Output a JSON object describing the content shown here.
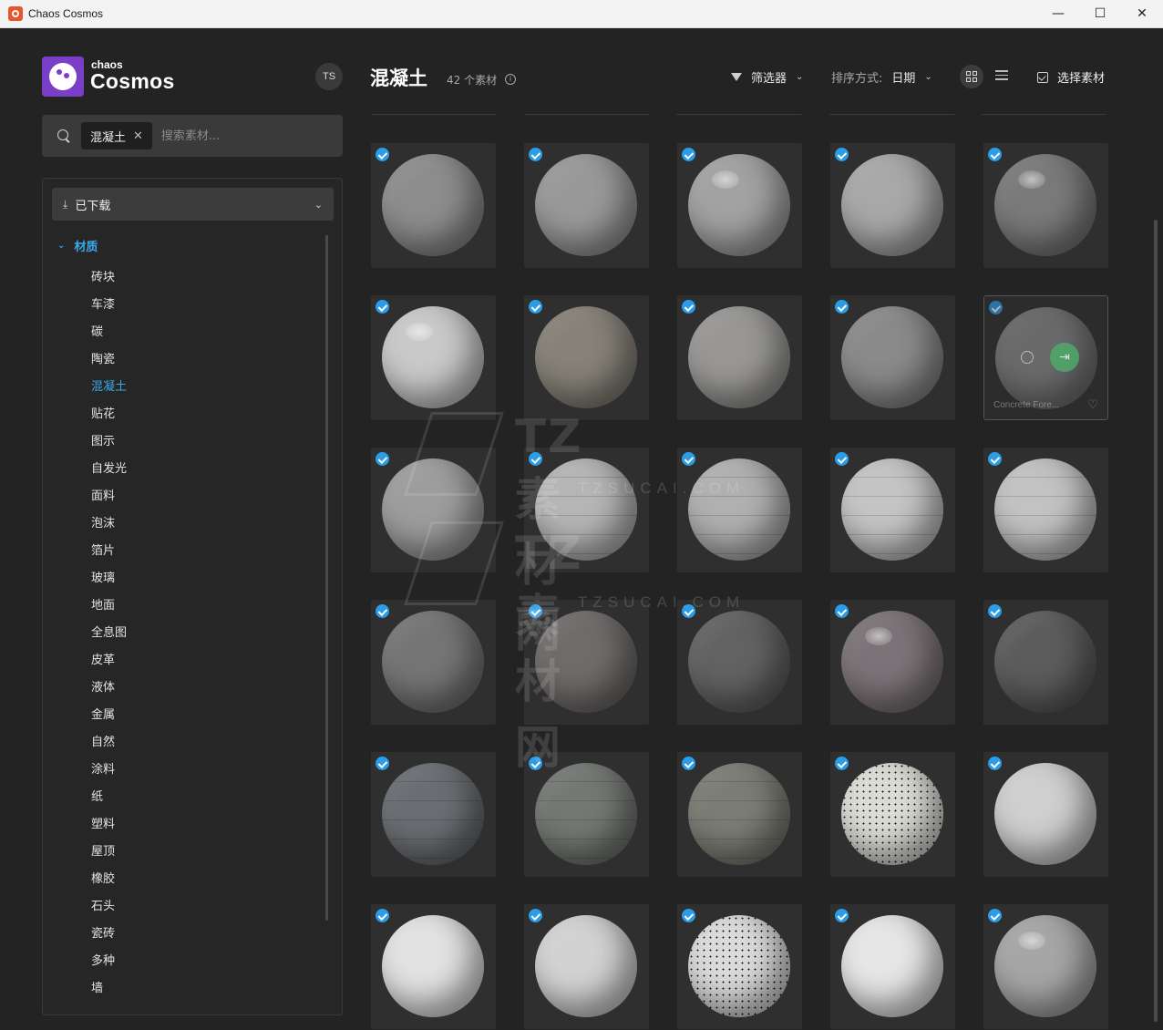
{
  "window": {
    "title": "Chaos Cosmos",
    "controls": [
      "—",
      "☐",
      "✕"
    ]
  },
  "brand": {
    "small": "chaos",
    "big": "Cosmos"
  },
  "user": {
    "initials": "TS"
  },
  "search": {
    "chip": "混凝土",
    "chip_close": "✕",
    "placeholder": "搜索素材..."
  },
  "sidebar": {
    "dropdown_icon": "⤓",
    "dropdown_label": "已下载",
    "dropdown_chevron": "⌄",
    "category": "材质",
    "category_chevron": "⌄",
    "items": [
      "砖块",
      "车漆",
      "碳",
      "陶瓷",
      "混凝土",
      "贴花",
      "图示",
      "自发光",
      "面料",
      "泡沫",
      "箔片",
      "玻璃",
      "地面",
      "全息图",
      "皮革",
      "液体",
      "金属",
      "自然",
      "涂料",
      "纸",
      "塑料",
      "屋顶",
      "橡胶",
      "石头",
      "瓷砖",
      "多种",
      "墙"
    ],
    "active_item": "混凝土"
  },
  "header": {
    "title": "混凝土",
    "count": "42 个素材",
    "info_icon": "i",
    "filter_label": "筛选器",
    "filter_chevron": "⌄",
    "sort_label": "排序方式:",
    "sort_value": "日期",
    "sort_chevron": "⌄",
    "select_label": "选择素材"
  },
  "hover_card": {
    "name": "Concrete Fore...",
    "apply_icon": "⇥",
    "heart_icon": "♡"
  },
  "watermark": {
    "text1": "TZ素材网",
    "sub1": "TZSUCAI.COM",
    "text2": "TZ素材网",
    "sub2": "TZSUCAI.COM"
  },
  "materials": [
    {
      "color": "#8d8d8d",
      "style": "plain"
    },
    {
      "color": "#999999",
      "style": "plain"
    },
    {
      "color": "#a2a2a2",
      "style": "glossy"
    },
    {
      "color": "#a8a8a8",
      "style": "plain"
    },
    {
      "color": "#7a7a7a",
      "style": "glossy"
    },
    {
      "color": "#c9c9c9",
      "style": "glossy"
    },
    {
      "color": "#868278",
      "style": "plain"
    },
    {
      "color": "#989795",
      "style": "plain"
    },
    {
      "color": "#8a8a8a",
      "style": "plain"
    },
    {
      "color": "#8e8e8e",
      "style": "hover"
    },
    {
      "color": "#9d9d9d",
      "style": "plain"
    },
    {
      "color": "#b5b5b5",
      "style": "band"
    },
    {
      "color": "#b0b0b0",
      "style": "band"
    },
    {
      "color": "#c4c4c4",
      "style": "band"
    },
    {
      "color": "#c2c2c2",
      "style": "band"
    },
    {
      "color": "#757575",
      "style": "plain"
    },
    {
      "color": "#6f6b6a",
      "style": "plain"
    },
    {
      "color": "#626262",
      "style": "plain"
    },
    {
      "color": "#7b7377",
      "style": "glossy"
    },
    {
      "color": "#5c5c5c",
      "style": "plain"
    },
    {
      "color": "#6a6e72",
      "style": "band"
    },
    {
      "color": "#747873",
      "style": "band"
    },
    {
      "color": "#7b7d74",
      "style": "band"
    },
    {
      "color": "#dcdcd6",
      "style": "speck"
    },
    {
      "color": "#cfcfcf",
      "style": "plain"
    },
    {
      "color": "#e2e2e2",
      "style": "plain"
    },
    {
      "color": "#d2d2d2",
      "style": "plain"
    },
    {
      "color": "#dadada",
      "style": "speck"
    },
    {
      "color": "#e6e6e6",
      "style": "plain"
    },
    {
      "color": "#a6a6a6",
      "style": "glossy"
    }
  ]
}
